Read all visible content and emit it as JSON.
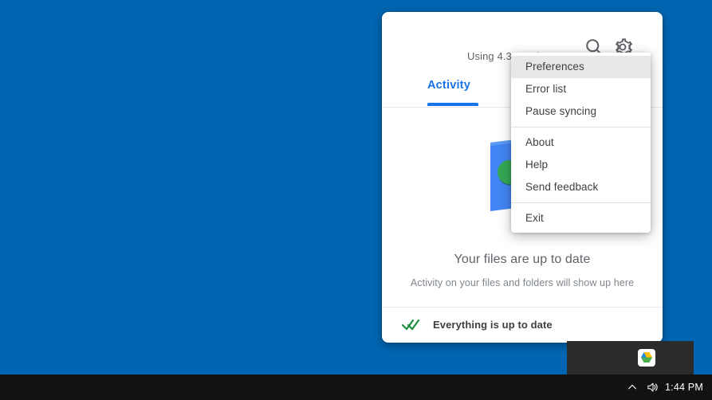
{
  "desktop": {
    "background_color": "#0066b3"
  },
  "drive_card": {
    "header": {
      "search_icon": "search-icon",
      "settings_icon": "gear-icon",
      "storage_text": "Using 4.3GB of 15.0GB"
    },
    "tabs": [
      {
        "label": "Activity",
        "selected": true
      },
      {
        "label": "",
        "selected": false
      }
    ],
    "empty_state": {
      "illustration": "cloud-check-illustration",
      "title": "Your files are up to date",
      "subtitle": "Activity on your files and folders will show up here"
    },
    "footer": {
      "status_icon": "double-check-icon",
      "status_text": "Everything is up to date"
    }
  },
  "context_menu": {
    "items": [
      {
        "label": "Preferences",
        "highlighted": true
      },
      {
        "label": "Error list",
        "highlighted": false
      },
      {
        "label": "Pause syncing",
        "highlighted": false
      },
      {
        "label": "About",
        "highlighted": false
      },
      {
        "label": "Help",
        "highlighted": false
      },
      {
        "label": "Send feedback",
        "highlighted": false
      },
      {
        "label": "Exit",
        "highlighted": false
      }
    ]
  },
  "tray_panel": {
    "drive_icon": "google-drive-icon"
  },
  "taskbar": {
    "chevron_icon": "chevron-up-icon",
    "volume_icon": "speaker-icon",
    "clock": "1:44 PM"
  },
  "colors": {
    "desktop_blue": "#0066b3",
    "accent_blue": "#1a73e8",
    "taskbar_dark": "#121212",
    "tray_panel_dark": "#2b2b2b",
    "status_green": "#1e8e3e"
  }
}
